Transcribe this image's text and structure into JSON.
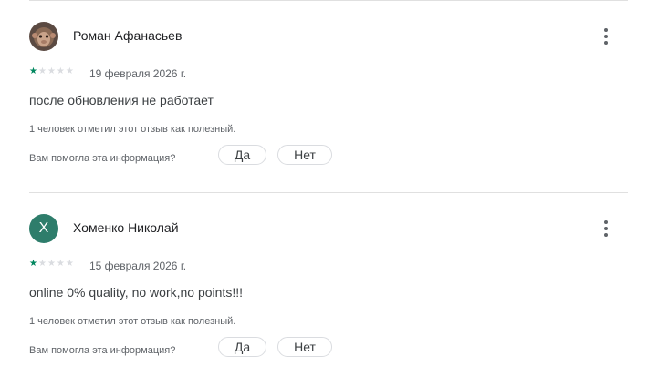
{
  "reviews": [
    {
      "author": "Роман Афанасьев",
      "avatar_icon": "monkey-photo-avatar",
      "rating": 1,
      "max_rating": 5,
      "date": "19 февраля 2026 г.",
      "text": "после обновления не работает",
      "helpful_count": "1 человек отметил этот отзыв как полезный.",
      "helpful_question": "Вам помогла эта информация?",
      "yes_label": "Да",
      "no_label": "Нет"
    },
    {
      "author": "Хоменко Николай",
      "avatar_letter": "Х",
      "rating": 1,
      "max_rating": 5,
      "date": "15 февраля 2026 г.",
      "text": "online 0% quality, no work,no points!!!",
      "helpful_count": "1 человек отметил этот отзыв как полезный.",
      "helpful_question": "Вам помогла эта информация?",
      "yes_label": "Да",
      "no_label": "Нет"
    }
  ],
  "colors": {
    "star_filled": "#01875f",
    "star_empty": "#dadce0",
    "avatar_letter_bg": "#2e7d6b"
  }
}
